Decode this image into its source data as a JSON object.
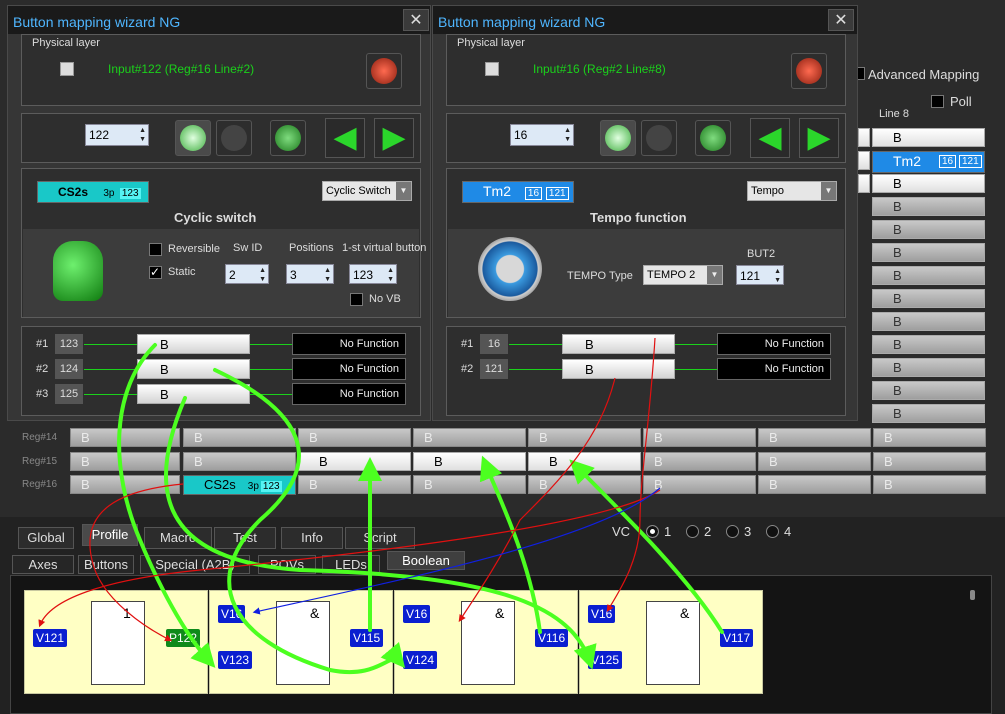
{
  "background": {
    "advanced_mapping": "Advanced Mapping",
    "line8": "Line 8",
    "poll": "Poll",
    "right_column_cells": [
      "B",
      "Tm2",
      "B",
      "B",
      "B",
      "B",
      "B",
      "B",
      "B",
      "B",
      "B",
      "B",
      "B"
    ],
    "tm2_badges": [
      "16",
      "121"
    ],
    "reg_labels": [
      "Reg#14",
      "Reg#15",
      "Reg#16"
    ],
    "reg14_cells": [
      "B",
      "B",
      "B",
      "B",
      "B",
      "B",
      "B",
      "B"
    ],
    "reg15_cells": [
      "B",
      "B",
      "B",
      "B",
      "B",
      "B",
      "B",
      "B"
    ],
    "reg16_cells": [
      "B",
      "CS2s",
      "B",
      "B",
      "B",
      "B",
      "B",
      "B"
    ],
    "cs2s_sub": "3p",
    "cs2s_badge": "123"
  },
  "wiz1": {
    "title": "Button mapping wizard NG",
    "close": "✕",
    "physical_layer": "Physical layer",
    "input_text": "Input#122 (Reg#16 Line#2)",
    "spin_value": "122",
    "mapping_name": "CS2s",
    "mapping_sub": "3p",
    "mapping_badge": "123",
    "function_select": "Cyclic Switch",
    "function_title": "Cyclic switch",
    "reversible": "Reversible",
    "static": "Static",
    "sw_id_label": "Sw ID",
    "positions_label": "Positions",
    "first_vb_label": "1-st virtual button",
    "sw_id": "2",
    "positions": "3",
    "first_vb": "123",
    "no_vb": "No VB",
    "rows": [
      {
        "idx": "#1",
        "num": "123",
        "btn": "B",
        "fn": "No Function"
      },
      {
        "idx": "#2",
        "num": "124",
        "btn": "B",
        "fn": "No Function"
      },
      {
        "idx": "#3",
        "num": "125",
        "btn": "B",
        "fn": "No Function"
      }
    ]
  },
  "wiz2": {
    "title": "Button mapping wizard NG",
    "close": "✕",
    "physical_layer": "Physical layer",
    "input_text": "Input#16 (Reg#2 Line#8)",
    "spin_value": "16",
    "mapping_name": "Tm2",
    "mapping_badges": [
      "16",
      "121"
    ],
    "function_select": "Tempo",
    "function_title": "Tempo function",
    "tempo_type_label": "TEMPO Type",
    "tempo_type": "TEMPO 2",
    "but2_label": "BUT2",
    "but2": "121",
    "rows": [
      {
        "idx": "#1",
        "num": "16",
        "btn": "B",
        "fn": "No Function"
      },
      {
        "idx": "#2",
        "num": "121",
        "btn": "B",
        "fn": "No Function"
      }
    ]
  },
  "bottom": {
    "tabs": [
      "Global",
      "Profile",
      "Macro",
      "Test",
      "Info",
      "Script"
    ],
    "subtabs": [
      "Axes",
      "Buttons",
      "Special (A2B)",
      "POVs",
      "LEDs",
      "Boolean"
    ],
    "vc_label": "VC",
    "vc_options": [
      "1",
      "2",
      "3",
      "4"
    ],
    "gates": [
      {
        "op": "1",
        "in1": "V121",
        "in2": "",
        "out": "P122"
      },
      {
        "op": "&",
        "in1": "V16",
        "in2": "V123",
        "out": "V115"
      },
      {
        "op": "&",
        "in1": "V16",
        "in2": "V124",
        "out": "V116"
      },
      {
        "op": "&",
        "in1": "V16",
        "in2": "V125",
        "out": "V117"
      }
    ]
  },
  "colors": {
    "accent": "#4fb6ff",
    "green": "#1bd11b",
    "vbutton": "#0a1fd0",
    "gate_bg": "#ffffc4"
  }
}
